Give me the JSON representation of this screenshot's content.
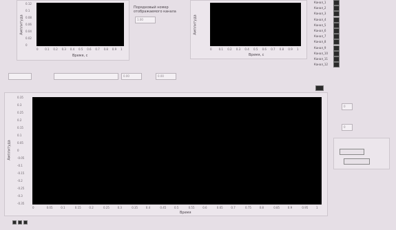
{
  "graph1": {
    "ylabel": "Амплитуда",
    "xlabel": "Время, с",
    "yticks": [
      "0.12",
      "0.1",
      "0.08",
      "0.06",
      "0.04",
      "0.02",
      "0"
    ],
    "xticks": [
      "0",
      "0.1",
      "0.2",
      "0.3",
      "0.4",
      "0.5",
      "0.6",
      "0.7",
      "0.8",
      "0.9",
      "1"
    ]
  },
  "graph2": {
    "ylabel": "Амплитуда",
    "xlabel": "Время, с",
    "yticks": [
      "",
      "",
      "",
      "",
      "",
      "",
      ""
    ],
    "xticks": [
      "0",
      "0.1",
      "0.2",
      "0.3",
      "0.4",
      "0.5",
      "0.6",
      "0.7",
      "0.8",
      "0.9",
      "1"
    ]
  },
  "channel_control": {
    "label": "Порядковый номер отображаемого канала",
    "value": "1.00"
  },
  "channels": [
    "Канал_1",
    "Канал_2",
    "Канал_3",
    "Канал_4",
    "Канал_5",
    "Канал_6",
    "Канал_7",
    "Канал_8",
    "Канал_9",
    "Канал_10",
    "Канал_11",
    "Канал_12"
  ],
  "fields": [
    {
      "label": "",
      "value": ""
    },
    {
      "label": "",
      "value": ""
    },
    {
      "label": "",
      "value": "0.00"
    },
    {
      "label": "",
      "value": "0.00"
    }
  ],
  "main_graph": {
    "title": "",
    "ylabel": "Амплитуда",
    "xlabel": "Время",
    "legend_label": "",
    "yticks": [
      "0.35",
      "0.3",
      "0.25",
      "0.2",
      "0.15",
      "0.1",
      "0.05",
      "0",
      "-0.05",
      "-0.1",
      "-0.15",
      "-0.2",
      "-0.25",
      "-0.3",
      "-0.35"
    ],
    "xticks": [
      "0",
      "0.05",
      "0.1",
      "0.15",
      "0.2",
      "0.25",
      "0.3",
      "0.35",
      "0.4",
      "0.45",
      "0.5",
      "0.55",
      "0.6",
      "0.65",
      "0.7",
      "0.75",
      "0.8",
      "0.85",
      "0.9",
      "0.95",
      "1"
    ]
  },
  "right_panel": {
    "label1": "",
    "value1": "0",
    "label2": "",
    "value2": "0",
    "group_label": "",
    "button1": "",
    "button2": ""
  },
  "status": {
    "text": ""
  }
}
